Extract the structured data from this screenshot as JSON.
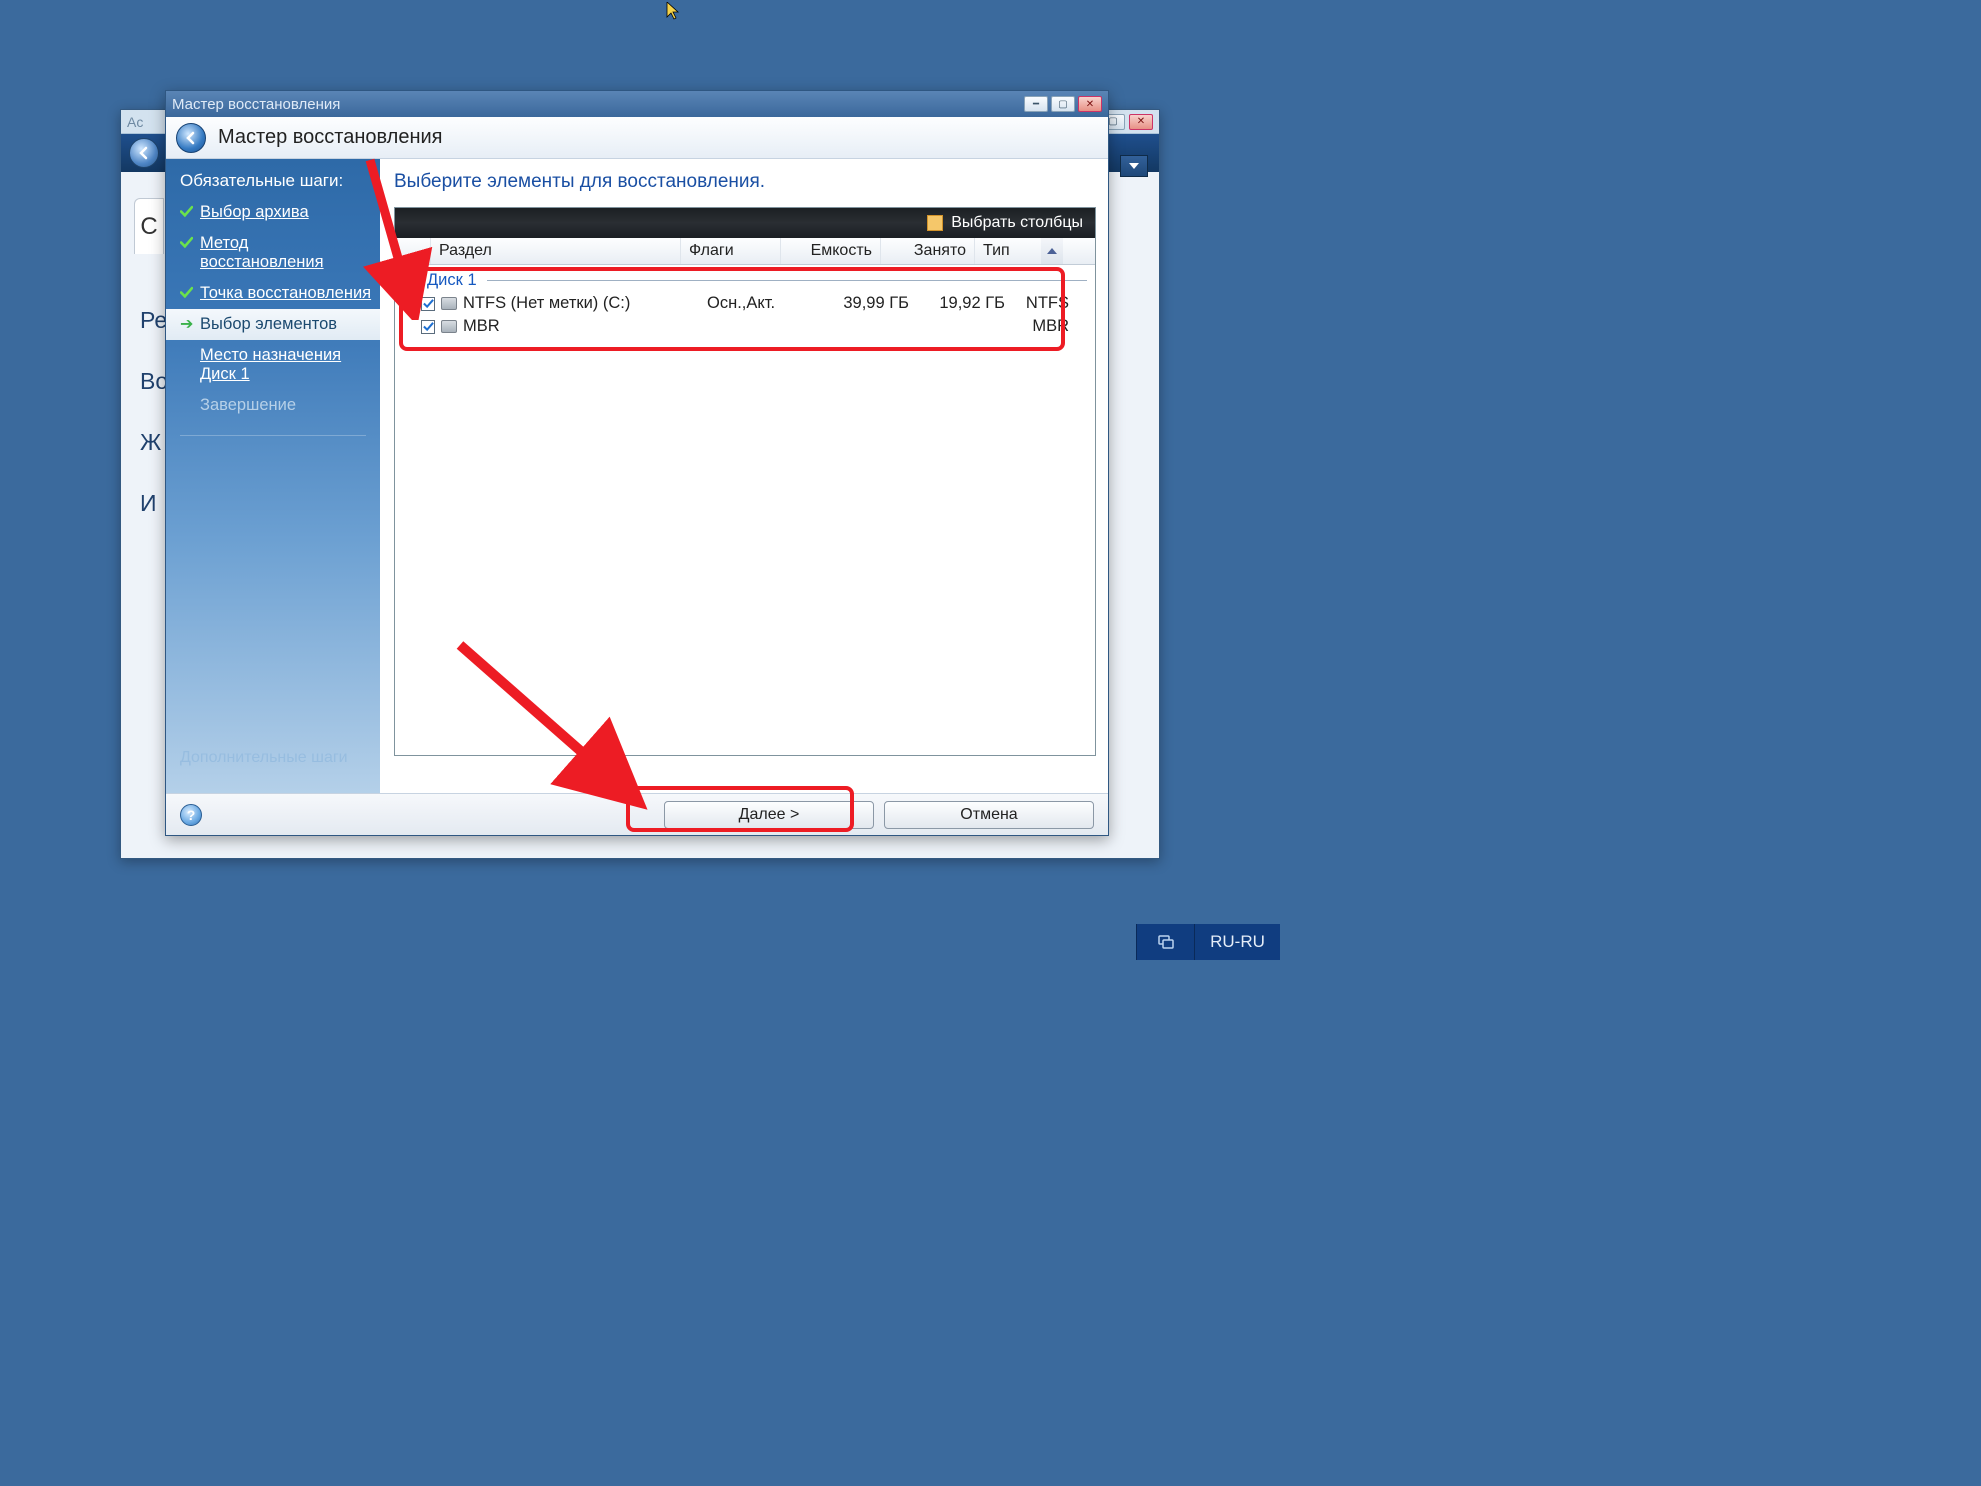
{
  "cursor_top_glyph": "▲",
  "bg_window": {
    "title_left": "Ас",
    "tab_text": "С",
    "sidebar_snips": [
      "Ре",
      "Во",
      "Ж",
      "И"
    ]
  },
  "wizard": {
    "titlebar": "Мастер восстановления",
    "header": "Мастер восстановления",
    "sidebar": {
      "section": "Обязательные шаги:",
      "steps": [
        {
          "label": "Выбор архива"
        },
        {
          "label": "Метод восстановления"
        },
        {
          "label": "Точка восстановления"
        },
        {
          "label": "Выбор элементов"
        },
        {
          "label": "Место назначения Диск 1"
        },
        {
          "label": "Завершение"
        }
      ],
      "extra": "Дополнительные шаги"
    },
    "main": {
      "title": "Выберите элементы для восстановления.",
      "select_columns": "Выбрать столбцы",
      "columns": {
        "partition": "Раздел",
        "flags": "Флаги",
        "capacity": "Емкость",
        "used": "Занято",
        "type": "Тип"
      },
      "group": "Диск 1",
      "rows": [
        {
          "name": "NTFS (Нет метки) (C:)",
          "flags": "Осн.,Акт.",
          "capacity": "39,99 ГБ",
          "used": "19,92 ГБ",
          "type": "NTFS"
        },
        {
          "name": "MBR",
          "flags": "",
          "capacity": "",
          "used": "",
          "type": "MBR"
        }
      ]
    },
    "footer": {
      "help": "?",
      "next": "Далее >",
      "cancel": "Отмена"
    }
  },
  "taskbar": {
    "lang": "RU-RU"
  }
}
